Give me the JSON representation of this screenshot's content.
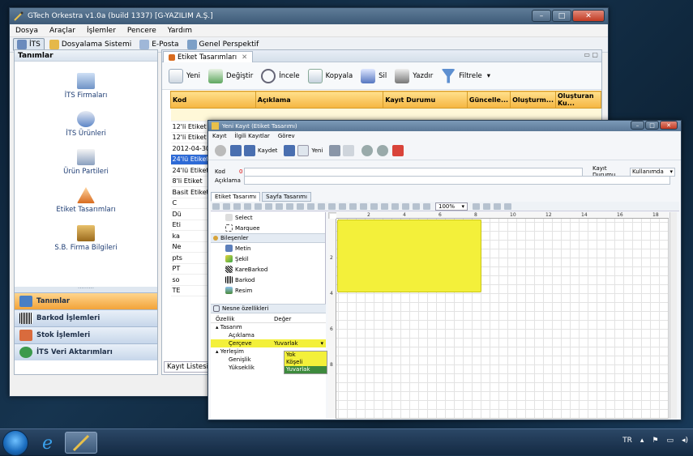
{
  "main_window": {
    "title": "GTech Orkestra v1.0a (build 1337) [G-YAZILIM A.Ş.]",
    "menu": [
      "Dosya",
      "Araçlar",
      "İşlemler",
      "Pencere",
      "Yardım"
    ],
    "toolbar": [
      "İTS",
      "Dosyalama Sistemi",
      "E-Posta",
      "Genel Perspektif"
    ]
  },
  "left_panel": {
    "header": "Tanımlar",
    "items": [
      "İTS Firmaları",
      "İTS Ürünleri",
      "Ürün Partileri",
      "Etiket Tasarımları",
      "S.B. Firma Bilgileri"
    ],
    "nav": [
      "Tanımlar",
      "Barkod İşlemleri",
      "Stok İşlemleri",
      "İTS Veri Aktarımları"
    ]
  },
  "right_panel": {
    "tab": "Etiket Tasarımları",
    "toolbar": [
      "Yeni",
      "Değiştir",
      "İncele",
      "Kopyala",
      "Sil",
      "Yazdır",
      "Filtrele"
    ],
    "columns": [
      "Kod",
      "Açıklama",
      "Kayıt Durumu",
      "Güncelle...",
      "Oluşturm...",
      "Oluşturan Ku..."
    ],
    "rows": [
      "12'li Etiket",
      "12'li Etiket /",
      "2012-04-30",
      "24'lü Etiket",
      "24'lü Etiket /",
      "8'li Etiket",
      "Basit Etiket",
      "C",
      "Dü",
      "Eti",
      "ka",
      "Ne",
      "pts",
      "PT",
      "so",
      "TE"
    ],
    "selected_row": 3,
    "bottom_tabs": [
      "Kayıt Listesi",
      "Fi"
    ]
  },
  "dialog": {
    "title": "Yeni Kayıt (Etiket Tasarımı)",
    "menu": [
      "Kayıt",
      "İlgili Kayıtlar",
      "Görev"
    ],
    "toolbar": [
      "Kaydet",
      "Yeni"
    ],
    "fields": {
      "kod_label": "Kod",
      "kod_value": "0",
      "aciklama_label": "Açıklama",
      "durum_label": "Kayıt Durumu",
      "durum_value": "Kullanımda"
    },
    "tabs": [
      "Etiket Tasarımı",
      "Sayfa Tasarımı"
    ],
    "zoom": "100%",
    "tools": [
      "Select",
      "Marquee"
    ],
    "components_header": "Bileşenler",
    "components": [
      "Metin",
      "Şekil",
      "KareBarkod",
      "Barkod",
      "Resim"
    ],
    "props_header": "Nesne özellikleri",
    "props_cols": [
      "Özellik",
      "Değer"
    ],
    "props": [
      {
        "k": "Tasarım",
        "v": ""
      },
      {
        "k": "Açıklama",
        "v": ""
      },
      {
        "k": "Çerçeve",
        "v": "Yuvarlak"
      },
      {
        "k": "Yerleşim",
        "v": ""
      },
      {
        "k": "Genişlik",
        "v": ""
      },
      {
        "k": "Yükseklik",
        "v": ""
      }
    ],
    "dropdown_options": [
      "Yok",
      "Köşeli",
      "Yuvarlak"
    ],
    "dropdown_selected": 2,
    "ruler_ticks": [
      "2",
      "4",
      "6",
      "8",
      "10",
      "12",
      "14",
      "16",
      "18"
    ]
  },
  "taskbar": {
    "lang": "TR",
    "clock": ""
  }
}
